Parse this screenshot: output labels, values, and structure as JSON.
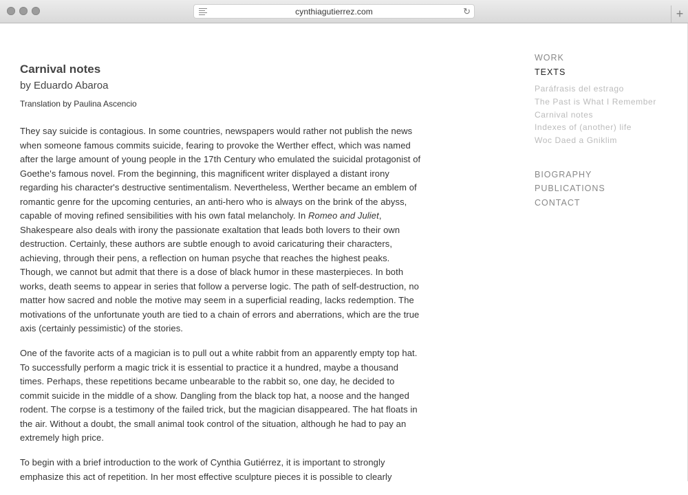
{
  "browser": {
    "url": "cynthiagutierrez.com",
    "new_tab_label": "+"
  },
  "article": {
    "title": "Carnival notes",
    "byline": "by Eduardo Abaroa",
    "translation": "Translation by Paulina Ascencio",
    "p1_part1": "They say suicide is contagious. In some countries, newspapers would rather not publish the news when someone famous commits suicide, fearing to provoke the Werther effect, which was named after the large amount of young people in the 17th Century who emulated the suicidal protagonist of Goethe's famous novel. From the beginning, this magnificent writer displayed a distant irony regarding his character's destructive sentimentalism. Nevertheless, Werther became an emblem of romantic genre for the upcoming centuries, an anti-hero who is always on the brink of the abyss, capable of moving refined sensibilities with his own fatal melancholy. In ",
    "p1_italic": "Romeo and Juliet",
    "p1_part2": ", Shakespeare also deals with irony the passionate exaltation that leads both lovers to their own destruction. Certainly, these authors are subtle enough to avoid caricaturing their characters, achieving, through their pens, a reflection on human psyche that reaches the highest peaks. Though, we cannot but admit that there is a dose of black humor in these masterpieces. In both works, death seems to appear in series that follow a perverse logic. The path of self-destruction, no matter how sacred and noble the motive may seem in a superficial reading, lacks redemption. The motivations of the unfortunate youth are tied to a chain of errors and aberrations, which are the true axis (certainly pessimistic) of the stories.",
    "p2": "One of the favorite acts of a magician is to pull out a white rabbit from an apparently empty top hat. To successfully perform a magic trick it is essential to practice it a hundred, maybe a thousand times. Perhaps, these repetitions became unbearable to the rabbit so, one day, he decided to commit suicide in the middle of a show. Dangling from the black top hat, a noose and the hanged rodent. The corpse is a testimony of the failed trick, but the magician disappeared. The hat floats in the air. Without a doubt, the small animal took control of the situation, although he had to pay an extremely high price.",
    "p3": "To begin with a brief introduction to the work of Cynthia Gutiérrez, it is important to strongly emphasize this act of repetition. In her most effective sculpture pieces it is possible to clearly"
  },
  "nav": {
    "work": "WORK",
    "texts": "TEXTS",
    "texts_items": [
      "Paráfrasis del estrago",
      "The Past is What I Remember",
      "Carnival notes",
      "Indexes of (another) life",
      "Woc Daed a Gniklim"
    ],
    "biography": "BIOGRAPHY",
    "publications": "PUBLICATIONS",
    "contact": "CONTACT"
  },
  "colors": {
    "nav_active": "#222222",
    "nav_inactive": "#888888",
    "subnav": "#bbbbbb",
    "text": "#333333"
  }
}
